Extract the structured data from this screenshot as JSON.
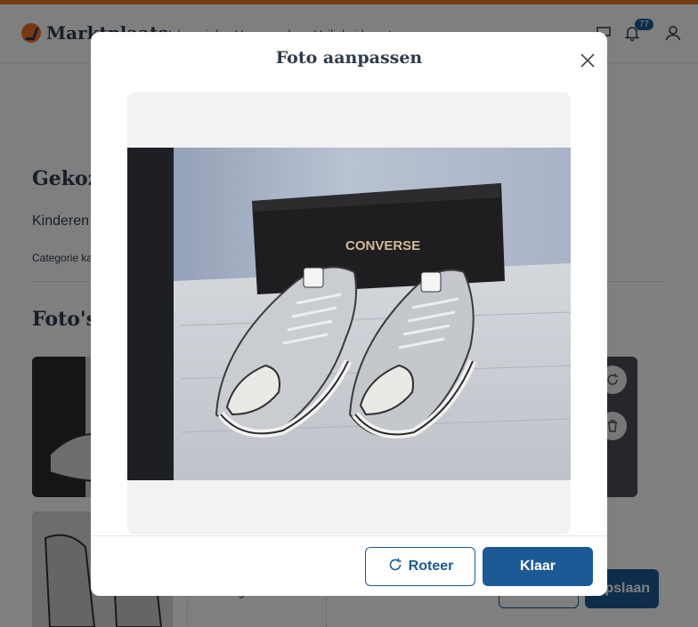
{
  "header": {
    "logo_text": "Marktplaats",
    "nav": [
      "Help en info",
      "Voorwaarden",
      "Veiligheidscentrum"
    ],
    "notification_count": "77"
  },
  "page": {
    "title": "Gekozen",
    "subtitle": "Kinderen",
    "category_label": "Categorie ka",
    "photos_title": "Foto's",
    "add_photo_label": "Voeg foto's toe",
    "save_label": "Opslaan"
  },
  "modal": {
    "title": "Foto aanpassen",
    "photo_brand_text": "CONVERSE",
    "rotate_label": "Roteer",
    "done_label": "Klaar"
  },
  "colors": {
    "accent": "#1c5a95",
    "brand_orange": "#ee7325",
    "text": "#2d3c4d"
  }
}
